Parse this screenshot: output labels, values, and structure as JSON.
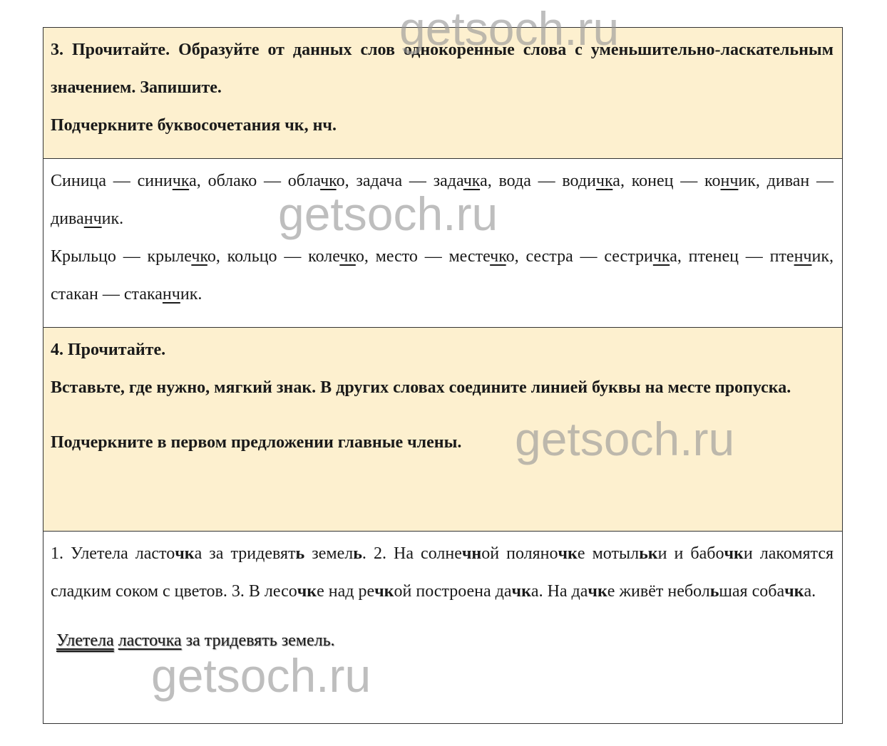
{
  "task3": {
    "heading": "3. Прочитайте. Образуйте от данных слов однокоренные слова с уменьшительно-ласкательным значением. Запишите.",
    "line2": "Подчеркните буквосочетания чк, нч."
  },
  "answer3": {
    "p1": [
      {
        "t": "Синица — сини"
      },
      {
        "t": "чк",
        "u": true
      },
      {
        "t": "а, облако — обла"
      },
      {
        "t": "чк",
        "u": true
      },
      {
        "t": "о, задача — зада"
      },
      {
        "t": "чк",
        "u": true
      },
      {
        "t": "а, вода — води"
      },
      {
        "t": "чк",
        "u": true
      },
      {
        "t": "а, конец — ко"
      },
      {
        "t": "нч",
        "u": true
      },
      {
        "t": "ик, диван — дива"
      },
      {
        "t": "нч",
        "u": true
      },
      {
        "t": "ик."
      }
    ],
    "p2": [
      {
        "t": "Крыльцо — крыле"
      },
      {
        "t": "чк",
        "u": true
      },
      {
        "t": "о, кольцо — коле"
      },
      {
        "t": "чк",
        "u": true
      },
      {
        "t": "о, место — месте"
      },
      {
        "t": "чк",
        "u": true
      },
      {
        "t": "о, сестра — сестри"
      },
      {
        "t": "чк",
        "u": true
      },
      {
        "t": "а, птенец — пте"
      },
      {
        "t": "нч",
        "u": true
      },
      {
        "t": "ик, стакан — стака"
      },
      {
        "t": "нч",
        "u": true
      },
      {
        "t": "ик."
      }
    ]
  },
  "task4": {
    "line1": "4. Прочитайте.",
    "line2": "Вставьте, где нужно, мягкий знак. В других словах соедините линией буквы на месте пропуска.",
    "line3": "Подчеркните в первом предложении главные члены."
  },
  "answer4": {
    "p1": [
      {
        "t": "1. Улетела ласто"
      },
      {
        "t": "чк",
        "b": true
      },
      {
        "t": "а за тридевят"
      },
      {
        "t": "ь",
        "b": true
      },
      {
        "t": " земел"
      },
      {
        "t": "ь",
        "b": true
      },
      {
        "t": ". 2. На солне"
      },
      {
        "t": "чн",
        "b": true
      },
      {
        "t": "ой поляно"
      },
      {
        "t": "чк",
        "b": true
      },
      {
        "t": "е мотыл"
      },
      {
        "t": "ьк",
        "b": true
      },
      {
        "t": "и и бабо"
      },
      {
        "t": "чк",
        "b": true
      },
      {
        "t": "и лакомятся сладким соком с цветов. 3. В лесо"
      },
      {
        "t": "чк",
        "b": true
      },
      {
        "t": "е над ре"
      },
      {
        "t": "чк",
        "b": true
      },
      {
        "t": "ой построена да"
      },
      {
        "t": "чк",
        "b": true
      },
      {
        "t": "а. На да"
      },
      {
        "t": "чк",
        "b": true
      },
      {
        "t": "е живёт небол"
      },
      {
        "t": "ь",
        "b": true
      },
      {
        "t": "шая соба"
      },
      {
        "t": "чк",
        "b": true
      },
      {
        "t": "а."
      }
    ],
    "parse": {
      "predicate": "Улетела",
      "subject": "ласточка",
      "rest": " за тридевять земель."
    }
  },
  "watermark": "getsoch.ru"
}
